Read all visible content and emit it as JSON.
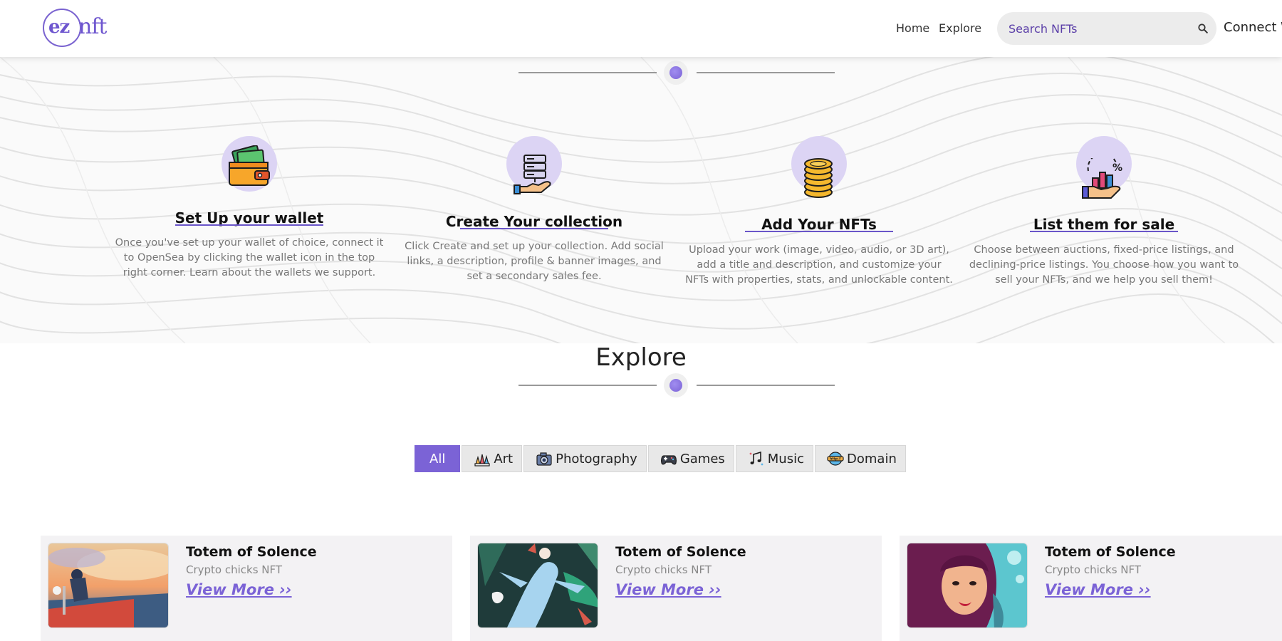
{
  "header": {
    "logo_left": "ez",
    "logo_right": "nft",
    "nav": [
      {
        "label": "Home"
      },
      {
        "label": "Explore"
      }
    ],
    "search_placeholder": "Search NFTs",
    "connect_label": "Connect W"
  },
  "steps": [
    {
      "title": "Set Up your wallet",
      "icon": "wallet-icon",
      "description": "Once you've set up your wallet of choice, connect it to OpenSea by clicking the wallet icon in the top right corner. Learn about the wallets we support."
    },
    {
      "title": "Create Your collection",
      "icon": "server-hand-icon",
      "description": "Click Create and set up your collection. Add social links, a description, profile & banner images, and set a secondary sales fee."
    },
    {
      "title": "Add Your NFTs",
      "icon": "coins-icon",
      "description": "Upload your work (image, video, audio, or 3D art), add a title and description, and customize your NFTs with properties, stats, and unlockable content."
    },
    {
      "title": "List them for sale",
      "icon": "sale-chart-icon",
      "description": "Choose between auctions, fixed-price listings, and declining-price listings. You choose how you want to sell your NFTs, and we help you sell them!"
    }
  ],
  "explore": {
    "title": "Explore",
    "tabs": [
      {
        "label": "All",
        "icon": ""
      },
      {
        "label": "Art",
        "icon": "art-icon"
      },
      {
        "label": "Photography",
        "icon": "camera-icon"
      },
      {
        "label": "Games",
        "icon": "gamepad-icon"
      },
      {
        "label": "Music",
        "icon": "music-icon"
      },
      {
        "label": "Domain",
        "icon": "domain-icon"
      }
    ],
    "active_tab": "All",
    "cards": [
      {
        "title": "Totem of Solence",
        "subtitle": "Crypto chicks NFT",
        "link": "View More ››"
      },
      {
        "title": "Totem of Solence",
        "subtitle": "Crypto chicks NFT",
        "link": "View More ››"
      },
      {
        "title": "Totem of Solence",
        "subtitle": "Crypto chicks NFT",
        "link": "View More ››"
      }
    ]
  },
  "colors": {
    "accent": "#7b63d6",
    "icon_bg": "#dcd4f4"
  }
}
